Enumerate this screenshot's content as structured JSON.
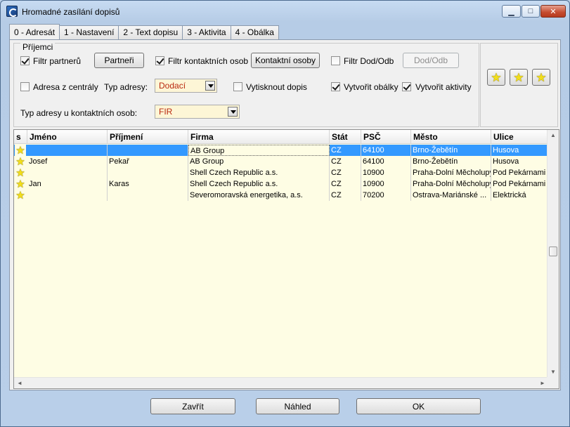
{
  "window": {
    "title": "Hromadné zasílání dopisů"
  },
  "tabs": [
    {
      "label": "0 - Adresát"
    },
    {
      "label": "1 - Nastavení"
    },
    {
      "label": "2 - Text dopisu"
    },
    {
      "label": "3 - Aktivita"
    },
    {
      "label": "4 - Obálka"
    }
  ],
  "recipients": {
    "legend": "Příjemci",
    "filtr_partneru": {
      "label": "Filtr partnerů",
      "checked": true
    },
    "partneri_button": "Partneři",
    "filtr_kontaktnich": {
      "label": "Filtr kontaktních osob",
      "checked": true
    },
    "kontaktni_button": "Kontaktní osoby",
    "filtr_dododb": {
      "label": "Filtr Dod/Odb",
      "checked": false
    },
    "dododb_button": "Dod/Odb",
    "adresa_z_centraly": {
      "label": "Adresa z centrály",
      "checked": false
    },
    "typ_adresy_label": "Typ adresy:",
    "typ_adresy_value": "Dodací",
    "vytisknout_dopis": {
      "label": "Vytisknout dopis",
      "checked": false
    },
    "vytvorit_obalky": {
      "label": "Vytvořit obálky",
      "checked": true
    },
    "vytvorit_aktivity": {
      "label": "Vytvořit aktivity",
      "checked": true
    },
    "typ_adresy_kontakt_label": "Typ adresy u kontaktních osob:",
    "typ_adresy_kontakt_value": "FIR"
  },
  "side_buttons": [
    "star-icon",
    "star-add-icon",
    "star-edit-icon"
  ],
  "grid": {
    "columns": [
      "s",
      "Jméno",
      "Příjmení",
      "Firma",
      "Stát",
      "PSČ",
      "Město",
      "Ulice"
    ],
    "rows": [
      {
        "jmeno": "",
        "prijmeni": "",
        "firma": "AB Group",
        "stat": "CZ",
        "psc": "64100",
        "mesto": "Brno-Žebětín",
        "ulice": "Husova"
      },
      {
        "jmeno": "Josef",
        "prijmeni": "Pekař",
        "firma": "AB Group",
        "stat": "CZ",
        "psc": "64100",
        "mesto": "Brno-Žebětín",
        "ulice": "Husova"
      },
      {
        "jmeno": "",
        "prijmeni": "",
        "firma": "Shell Czech Republic a.s.",
        "stat": "CZ",
        "psc": "10900",
        "mesto": "Praha-Dolní Měcholupy",
        "ulice": "Pod Pekárnami"
      },
      {
        "jmeno": "Jan",
        "prijmeni": "Karas",
        "firma": "Shell Czech Republic a.s.",
        "stat": "CZ",
        "psc": "10900",
        "mesto": "Praha-Dolní Měcholupy",
        "ulice": "Pod Pekárnami"
      },
      {
        "jmeno": "",
        "prijmeni": "",
        "firma": "Severomoravská energetika, a.s.",
        "stat": "CZ",
        "psc": "70200",
        "mesto": "Ostrava-Mariánské ...",
        "ulice": "Elektrická"
      }
    ]
  },
  "footer": {
    "zavrit": "Zavřít",
    "nahled": "Náhled",
    "ok": "OK"
  }
}
